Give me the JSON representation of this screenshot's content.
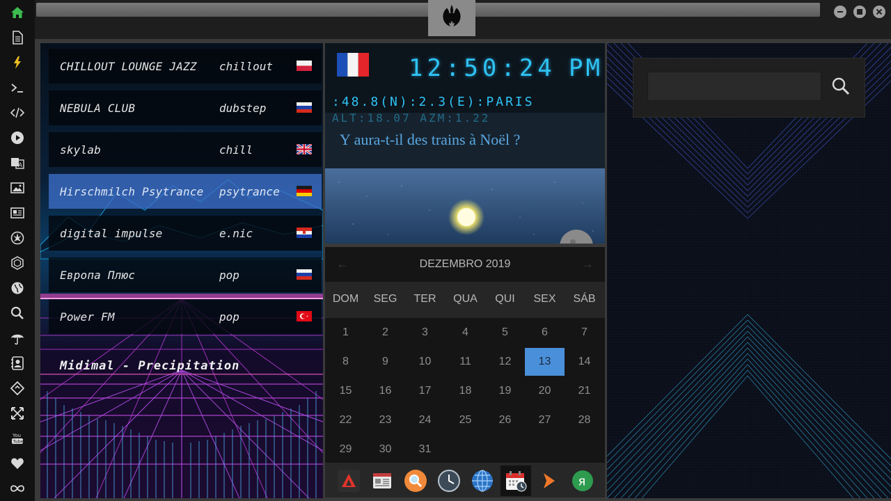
{
  "sidebar": {
    "items": [
      {
        "icon": "home-icon"
      },
      {
        "icon": "document-icon"
      },
      {
        "icon": "lightning-icon"
      },
      {
        "icon": "terminal-icon"
      },
      {
        "icon": "code-icon"
      },
      {
        "icon": "play-icon"
      },
      {
        "icon": "translate-icon"
      },
      {
        "icon": "image-icon"
      },
      {
        "icon": "newspaper-icon"
      },
      {
        "icon": "rebel-icon"
      },
      {
        "icon": "hexagon-icon"
      },
      {
        "icon": "globe-icon"
      },
      {
        "icon": "search-icon"
      },
      {
        "icon": "umbrella-icon"
      },
      {
        "icon": "contact-card-icon"
      },
      {
        "icon": "tag-icon"
      },
      {
        "icon": "expand-icon"
      },
      {
        "icon": "youtube-icon"
      },
      {
        "icon": "heart-icon"
      },
      {
        "icon": "infinity-icon"
      }
    ],
    "accent": "#3dbb4f"
  },
  "window": {
    "logo_icon": "rebel-alliance-icon"
  },
  "radio": {
    "stations": [
      {
        "name": "CHILLOUT LOUNGE JAZZ",
        "genre": "chillout",
        "flag": "poland-flag"
      },
      {
        "name": "NEBULA CLUB",
        "genre": "dubstep",
        "flag": "russia-flag"
      },
      {
        "name": "skylab",
        "genre": "chill",
        "flag": "uk-flag"
      },
      {
        "name": "Hirschmilch Psytrance",
        "genre": "psytrance",
        "flag": "germany-flag"
      },
      {
        "name": "digital impulse",
        "genre": "e.nic",
        "flag": "croatia-flag"
      },
      {
        "name": "Европа Плюс",
        "genre": "pop",
        "flag": "russia-flag"
      },
      {
        "name": "Power FM",
        "genre": "pop",
        "flag": "turkey-flag"
      }
    ],
    "active_index": 3,
    "now_playing": "Midimal - Precipitation"
  },
  "clock": {
    "flag": "france-flag",
    "time": "12:50:24",
    "ampm": "PM",
    "coords": ":48.8(N):2.3(E):PARIS",
    "alt": "ALT:18.07 AZM:1.22",
    "headline": "Y aura-t-il des trains à Noël ?"
  },
  "calendar": {
    "month_label": "DEZEMBRO 2019",
    "prev_label": "←",
    "next_label": "→",
    "weekdays": [
      "DOM",
      "SEG",
      "TER",
      "QUA",
      "QUI",
      "SEX",
      "SÁB"
    ],
    "weeks": [
      [
        "1",
        "2",
        "3",
        "4",
        "5",
        "6",
        "7"
      ],
      [
        "8",
        "9",
        "10",
        "11",
        "12",
        "13",
        "14"
      ],
      [
        "15",
        "16",
        "17",
        "18",
        "19",
        "20",
        "21"
      ],
      [
        "22",
        "23",
        "24",
        "25",
        "26",
        "27",
        "28"
      ],
      [
        "29",
        "30",
        "31"
      ]
    ],
    "today": "13",
    "today_color": "#4a8fd9"
  },
  "dock": {
    "items": [
      {
        "icon": "red-triangle-app-icon"
      },
      {
        "icon": "news-app-icon"
      },
      {
        "icon": "search-app-icon"
      },
      {
        "icon": "clock-app-icon"
      },
      {
        "icon": "globe-app-icon"
      },
      {
        "icon": "calendar-app-icon"
      },
      {
        "icon": "arrow-app-icon"
      },
      {
        "icon": "yandex-app-icon"
      }
    ],
    "active_index": 5
  },
  "search": {
    "value": "",
    "placeholder": ""
  }
}
